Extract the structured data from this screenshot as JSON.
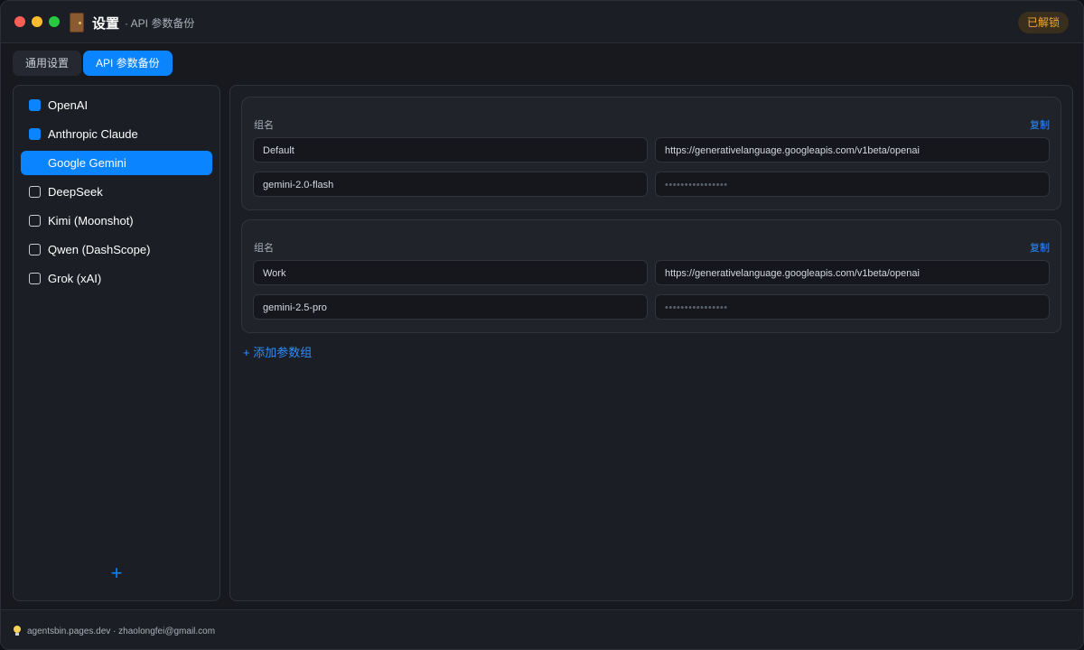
{
  "window": {
    "title": "设置",
    "subtitle": "· API 参数备份",
    "status_badge": "已解锁"
  },
  "tabs": [
    {
      "label": "通用设置",
      "active": false
    },
    {
      "label": "API 参数备份",
      "active": true
    }
  ],
  "providers": [
    {
      "label": "OpenAI",
      "checked": true,
      "active": false
    },
    {
      "label": "Anthropic Claude",
      "checked": true,
      "active": false
    },
    {
      "label": "Google Gemini",
      "checked": true,
      "active": true
    },
    {
      "label": "DeepSeek",
      "checked": false,
      "active": false
    },
    {
      "label": "Kimi (Moonshot)",
      "checked": false,
      "active": false
    },
    {
      "label": "Qwen (DashScope)",
      "checked": false,
      "active": false
    },
    {
      "label": "Grok (xAI)",
      "checked": false,
      "active": false
    }
  ],
  "add_provider_icon": "plus-icon",
  "groups": [
    {
      "label": "组名",
      "copy_label": "复制",
      "name": "Default",
      "base_url": "https://generativelanguage.googleapis.com/v1beta/openai",
      "model": "gemini-2.0-flash",
      "api_key_masked": "••••••••••••••••"
    },
    {
      "label": "组名",
      "copy_label": "复制",
      "name": "Work",
      "base_url": "https://generativelanguage.googleapis.com/v1beta/openai",
      "model": "gemini-2.5-pro",
      "api_key_masked": "••••••••••••••••"
    }
  ],
  "add_group_label": "+ 添加参数组",
  "footer": {
    "text": "agentsbin.pages.dev · zhaolongfei@gmail.com",
    "icon": "lightbulb-icon"
  },
  "colors": {
    "accent": "#0b84ff",
    "badge_text": "#f0a832",
    "background": "#17191f"
  }
}
